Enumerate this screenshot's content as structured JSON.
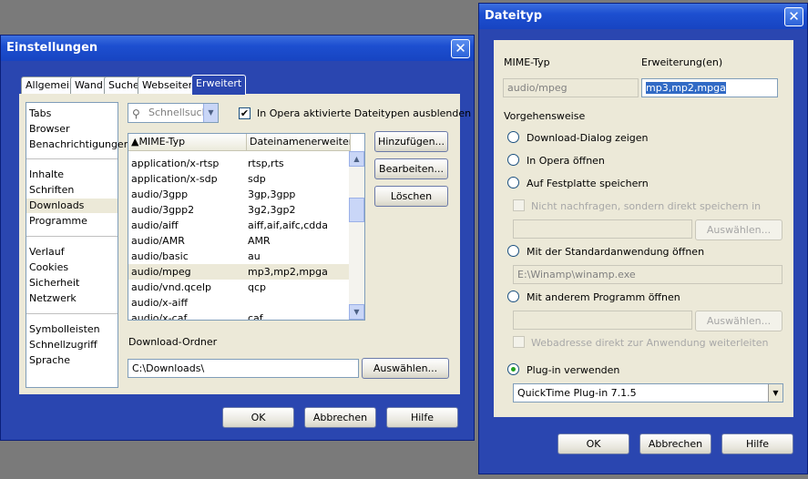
{
  "settings": {
    "title": "Einstellungen",
    "close": "✕",
    "tabs": [
      "Allgemein",
      "Wand",
      "Suche",
      "Webseiten",
      "Erweitert"
    ],
    "sidebar_groups": [
      [
        "Tabs",
        "Browser",
        "Benachrichtigungen"
      ],
      [
        "Inhalte",
        "Schriften",
        "Downloads",
        "Programme"
      ],
      [
        "Verlauf",
        "Cookies",
        "Sicherheit",
        "Netzwerk"
      ],
      [
        "Symbolleisten",
        "Schnellzugriff",
        "Sprache"
      ]
    ],
    "quickfind_placeholder": "Schnellsuch",
    "hide_checkbox_label": "In Opera aktivierte Dateitypen ausblenden",
    "columns": [
      "▲MIME-Typ",
      "Dateinamenerweiterun..."
    ],
    "rows": [
      {
        "mime": "application/x-rtsp",
        "ext": "rtsp,rts"
      },
      {
        "mime": "application/x-sdp",
        "ext": "sdp"
      },
      {
        "mime": "audio/3gpp",
        "ext": "3gp,3gpp"
      },
      {
        "mime": "audio/3gpp2",
        "ext": "3g2,3gp2"
      },
      {
        "mime": "audio/aiff",
        "ext": "aiff,aif,aifc,cdda"
      },
      {
        "mime": "audio/AMR",
        "ext": "AMR"
      },
      {
        "mime": "audio/basic",
        "ext": "au"
      },
      {
        "mime": "audio/mpeg",
        "ext": "mp3,mp2,mpga"
      },
      {
        "mime": "audio/vnd.qcelp",
        "ext": "qcp"
      },
      {
        "mime": "audio/x-aiff",
        "ext": ""
      },
      {
        "mime": "audio/x-caf",
        "ext": "caf"
      }
    ],
    "buttons": {
      "add": "Hinzufügen...",
      "edit": "Bearbeiten...",
      "delete": "Löschen",
      "choose": "Auswählen...",
      "ok": "OK",
      "cancel": "Abbrechen",
      "help": "Hilfe"
    },
    "download_folder_label": "Download-Ordner",
    "download_folder_value": "C:\\Downloads\\"
  },
  "filetype": {
    "title": "Dateityp",
    "close": "✕",
    "mime_label": "MIME-Typ",
    "ext_label": "Erweiterung(en)",
    "mime_value": "audio/mpeg",
    "ext_value": "mp3,mp2,mpga",
    "procedure_label": "Vorgehensweise",
    "opt_dialog": "Download-Dialog zeigen",
    "opt_opera": "In Opera öffnen",
    "opt_save": "Auf Festplatte speichern",
    "no_ask": "Nicht nachfragen, sondern direkt speichern in",
    "opt_default": "Mit der Standardanwendung öffnen",
    "default_app": "E:\\Winamp\\winamp.exe",
    "opt_other": "Mit anderem Programm öffnen",
    "pass_url": "Webadresse direkt zur Anwendung weiterleiten",
    "opt_plugin": "Plug-in verwenden",
    "plugin_value": "QuickTime Plug-in 7.1.5",
    "choose": "Auswählen...",
    "ok": "OK",
    "cancel": "Abbrechen",
    "help": "Hilfe"
  }
}
